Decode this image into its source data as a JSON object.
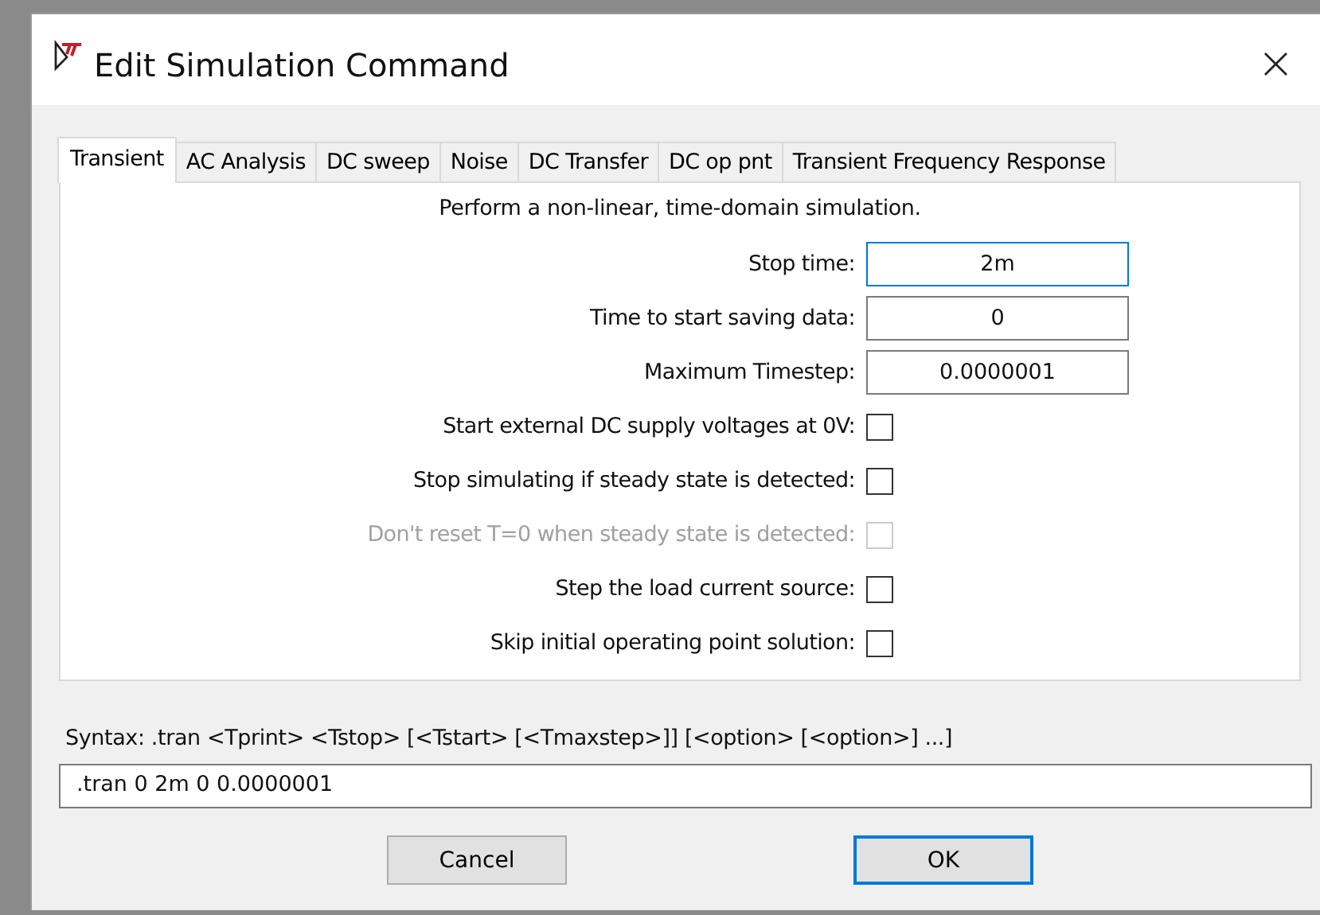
{
  "window": {
    "title": "Edit Simulation Command",
    "close": "×"
  },
  "tabs": [
    {
      "label": "Transient",
      "selected": true
    },
    {
      "label": "AC Analysis",
      "selected": false
    },
    {
      "label": "DC sweep",
      "selected": false
    },
    {
      "label": "Noise",
      "selected": false
    },
    {
      "label": "DC Transfer",
      "selected": false
    },
    {
      "label": "DC op pnt",
      "selected": false
    },
    {
      "label": "Transient Frequency Response",
      "selected": false
    }
  ],
  "description": "Perform a non-linear, time-domain simulation.",
  "fields": [
    {
      "kind": "text",
      "label": "Stop time:",
      "value": "2m",
      "focused": true
    },
    {
      "kind": "text",
      "label": "Time to start saving data:",
      "value": "0",
      "focused": false
    },
    {
      "kind": "text",
      "label": "Maximum Timestep:",
      "value": "0.0000001",
      "focused": false
    },
    {
      "kind": "checkbox",
      "label": "Start external DC supply voltages at 0V:",
      "checked": false,
      "disabled": false
    },
    {
      "kind": "checkbox",
      "label": "Stop simulating if steady state is detected:",
      "checked": false,
      "disabled": false
    },
    {
      "kind": "checkbox",
      "label": "Don't reset T=0 when steady state is detected:",
      "checked": false,
      "disabled": true
    },
    {
      "kind": "checkbox",
      "label": "Step the load current source:",
      "checked": false,
      "disabled": false
    },
    {
      "kind": "checkbox",
      "label": "Skip initial operating point solution:",
      "checked": false,
      "disabled": false
    }
  ],
  "syntax": "Syntax:  .tran <Tprint> <Tstop> [<Tstart> [<Tmaxstep>]] [<option> [<option>] ...]",
  "command": ".tran 0 2m 0 0.0000001",
  "buttons": [
    {
      "label": "Cancel",
      "default": false
    },
    {
      "label": "OK",
      "default": true
    }
  ]
}
